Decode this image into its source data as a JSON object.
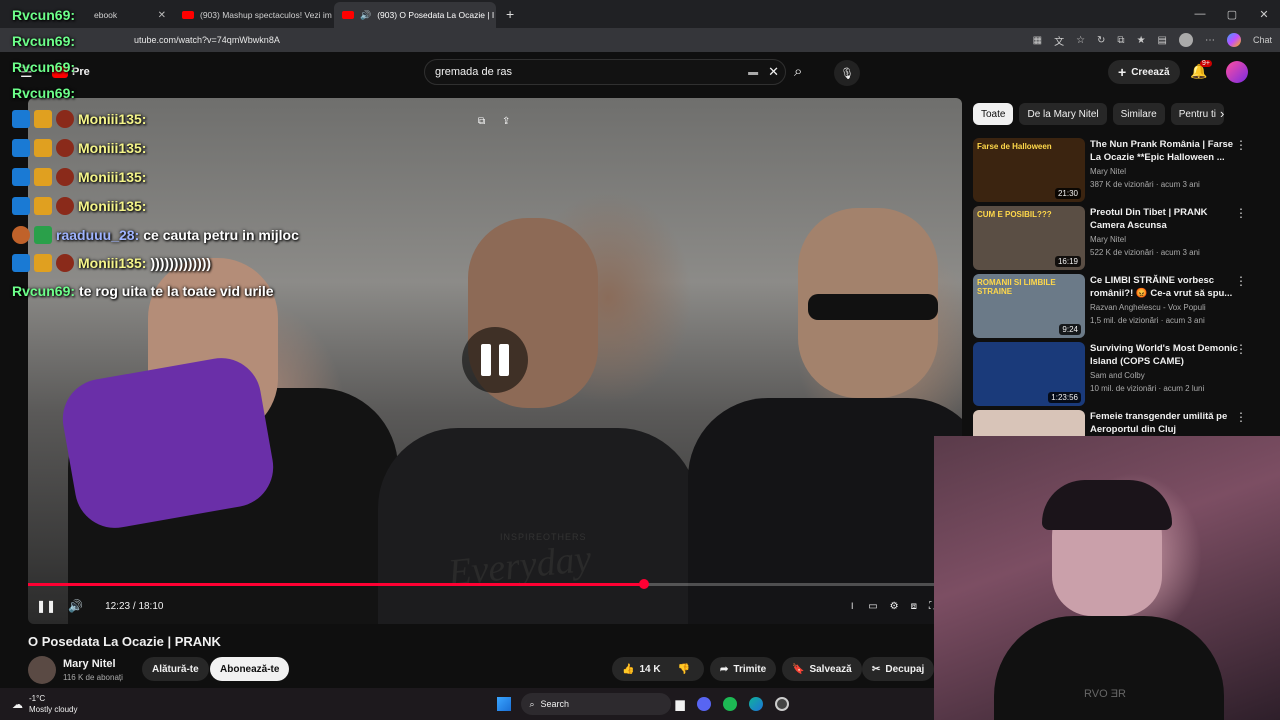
{
  "browser": {
    "tabs": [
      {
        "label": "ebook",
        "active": false
      },
      {
        "label": "(903) Mashup spectaculos! Vezi im",
        "active": false
      },
      {
        "label": "(903) O Posedata La Ocazie | I",
        "active": true
      }
    ],
    "new_tab": "+",
    "url": "utube.com/watch?v=74qmWbwkn8A",
    "chat_label": "Chat",
    "win_min": "—",
    "win_max": "▢",
    "win_close": "✕"
  },
  "youtube": {
    "logo_label": "Pre",
    "search_value": "gremada de ras",
    "create_label": "Creează",
    "notif_badge": "9+",
    "video": {
      "title": "O Posedata La Ocazie | PRANK",
      "time_current": "12:23",
      "time_total": "18:10",
      "progress_fraction": 0.68,
      "buffer_fraction": 0.73,
      "shirt_brand": "Everyday",
      "shirt_small": "INSPIREOTHERS"
    },
    "channel": {
      "name": "Mary Nitel",
      "subs": "116 K de abonați",
      "join_label": "Alătură-te",
      "subscribe_label": "Abonează-te"
    },
    "actions": {
      "likes": "14 K",
      "share": "Trimite",
      "save": "Salvează",
      "clip": "Decupaj"
    },
    "chips": [
      "Toate",
      "De la Mary Nitel",
      "Similare",
      "Pentru ti"
    ],
    "recommendations": [
      {
        "title": "The Nun Prank România | Farse La Ocazie **Epic Halloween ...",
        "channel": "Mary Nitel",
        "meta": "387 K de vizionări · acum 3 ani",
        "duration": "21:30",
        "thumb_text": "Farse de Halloween"
      },
      {
        "title": "Preotul Din Tibet | PRANK Camera Ascunsa",
        "channel": "Mary Nitel",
        "meta": "522 K de vizionări · acum 3 ani",
        "duration": "16:19",
        "thumb_text": "CUM E POSIBIL???"
      },
      {
        "title": "Ce LIMBI STRĂINE vorbesc românii?! 😡 Ce-a vrut să spu...",
        "channel": "Razvan Anghelescu - Vox Populi",
        "meta": "1,5 mil. de vizionări · acum 3 ani",
        "duration": "9:24",
        "thumb_text": "ROMANII SI LIMBILE STRAINE"
      },
      {
        "title": "Surviving World's Most Demonic Island (COPS CAME)",
        "channel": "Sam and Colby",
        "meta": "10 mil. de vizionări · acum 2 luni",
        "duration": "1:23:56",
        "thumb_text": ""
      },
      {
        "title": "Femeie transgender umilită pe Aeroportul din Cluj",
        "channel": "",
        "meta": "",
        "duration": "",
        "thumb_text": ""
      }
    ]
  },
  "chat_overlay": [
    {
      "user": "Rvcun69:",
      "text": "",
      "user_color": "#6dff8a"
    },
    {
      "user": "Rvcun69:",
      "text": "",
      "user_color": "#6dff8a"
    },
    {
      "user": "Rvcun69:",
      "text": "",
      "user_color": "#6dff8a"
    },
    {
      "user": "Rvcun69:",
      "text": "",
      "user_color": "#6dff8a"
    },
    {
      "user": "Moniii135:",
      "text": "",
      "user_color": "#f5f58a"
    },
    {
      "user": "Moniii135:",
      "text": "",
      "user_color": "#f5f58a"
    },
    {
      "user": "Moniii135:",
      "text": "",
      "user_color": "#f5f58a"
    },
    {
      "user": "Moniii135:",
      "text": "",
      "user_color": "#f5f58a"
    },
    {
      "user": "raaduuu_28:",
      "text": "ce cauta petru in mijloc",
      "user_color": "#9fb4ff"
    },
    {
      "user": "Moniii135:",
      "text": ")))))))))))))",
      "user_color": "#f5f58a"
    },
    {
      "user": "Rvcun69:",
      "text": "te rog uita te la toate vid urile",
      "user_color": "#6dff8a"
    }
  ],
  "taskbar": {
    "temp": "-1°C",
    "weather": "Mostly cloudy",
    "search": "Search"
  },
  "webcam": {
    "shirt_text": "RVO ƎR"
  },
  "colors": {
    "accent": "#ff0033",
    "bg": "#0f0f0f",
    "chip": "#272727"
  }
}
